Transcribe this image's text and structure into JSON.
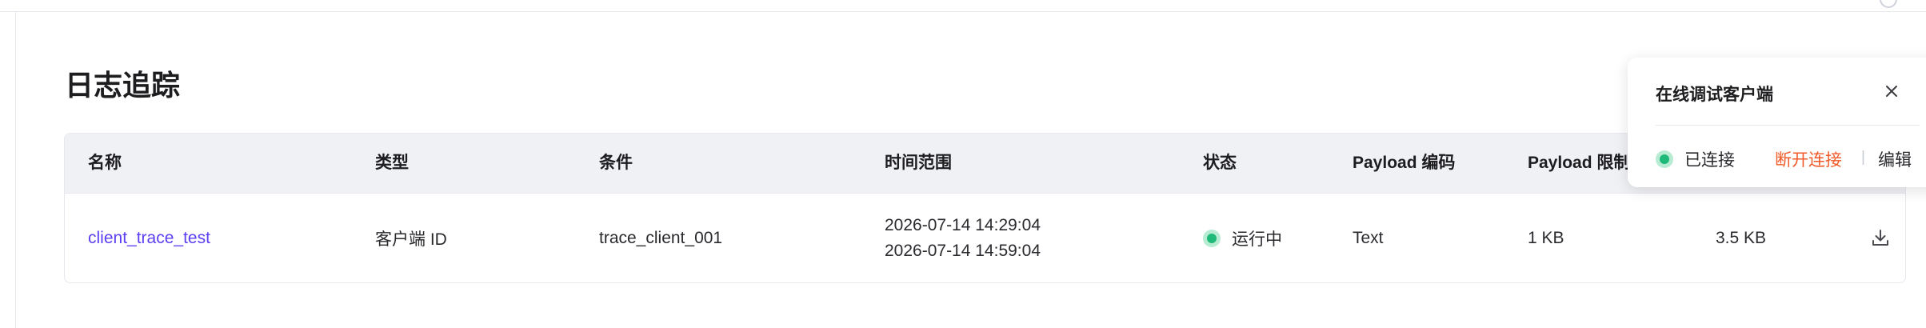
{
  "page": {
    "title": "日志追踪"
  },
  "table": {
    "columns": [
      "名称",
      "类型",
      "条件",
      "时间范围",
      "状态",
      "Payload 编码",
      "Payload 限制"
    ],
    "rows": [
      {
        "name": "client_trace_test",
        "type": "客户端 ID",
        "condition": "trace_client_001",
        "time_start": "2026-07-14 14:29:04",
        "time_end": "2026-07-14 14:59:04",
        "status": "运行中",
        "payload_encoding": "Text",
        "payload_limit": "1 KB",
        "size": "3.5 KB",
        "actions": [
          "download-icon",
          "link-disconnect-icon"
        ]
      }
    ]
  },
  "popover": {
    "title": "在线调试客户端",
    "status": "已连接",
    "disconnect_label": "断开连接",
    "separator": "|",
    "edit_label": "编辑"
  },
  "colors": {
    "link": "#5b3ff2",
    "status_green": "#1fb97a",
    "danger": "#f05a28",
    "header_bg": "#f0f1f5"
  }
}
